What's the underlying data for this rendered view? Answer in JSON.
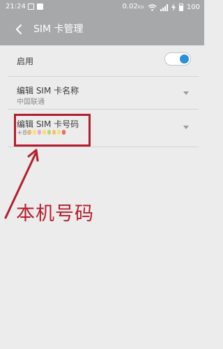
{
  "status_bar": {
    "time": "21:24",
    "data_speed": "0.02",
    "data_unit": "K/s",
    "battery": "100"
  },
  "app_bar": {
    "title": "SIM 卡管理"
  },
  "settings": {
    "enable": {
      "label": "启用",
      "on": true
    },
    "sim_name": {
      "label": "编辑 SIM 卡名称",
      "value": "中国联通"
    },
    "sim_number": {
      "label": "编辑 SIM 卡号码",
      "value": "+86"
    }
  },
  "annotation": {
    "text": "本机号码"
  },
  "colors": {
    "header_bg": "#a7a8aa",
    "page_bg": "#ececed",
    "toggle_accent": "#2c8fd8",
    "annotation_red": "#b41d2b"
  },
  "icons": [
    "back-arrow",
    "signal",
    "wifi",
    "battery",
    "chevron-down"
  ]
}
